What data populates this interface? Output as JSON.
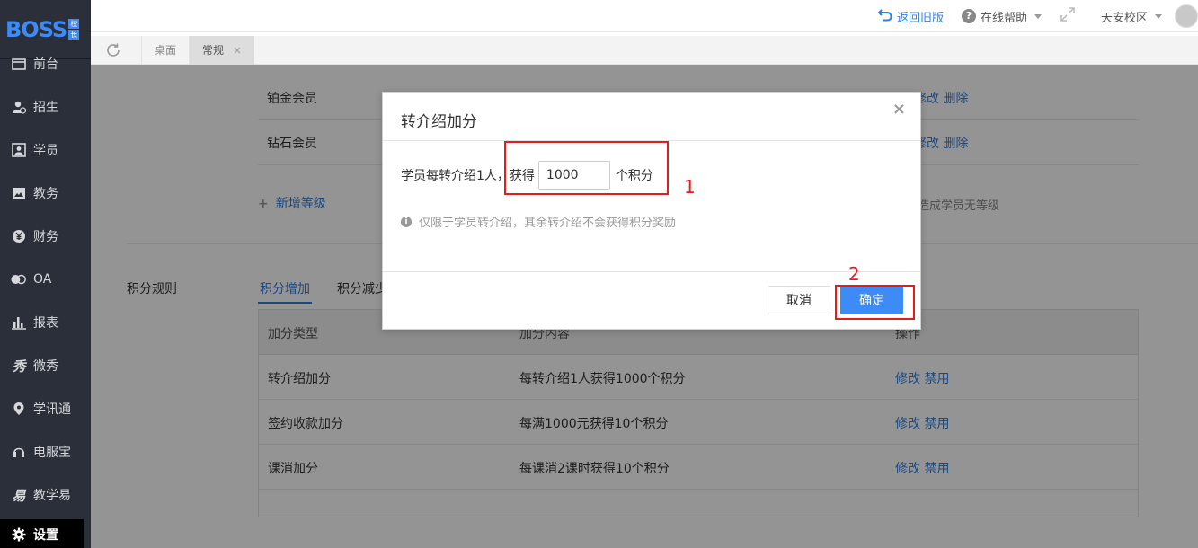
{
  "app": {
    "logo_text": "BOSS",
    "logo_badge": [
      "校",
      "长"
    ]
  },
  "sidebar": {
    "items": [
      {
        "label": "前台",
        "icon": "calendar-icon"
      },
      {
        "label": "招生",
        "icon": "add-user-icon"
      },
      {
        "label": "学员",
        "icon": "id-card-icon"
      },
      {
        "label": "教务",
        "icon": "picture-icon"
      },
      {
        "label": "财务",
        "icon": "yen-icon"
      },
      {
        "label": "OA",
        "icon": "toggle-icon"
      },
      {
        "label": "报表",
        "icon": "bar-chart-icon"
      },
      {
        "label": "微秀",
        "icon": "xiu-icon"
      },
      {
        "label": "学讯通",
        "icon": "location-pin-icon"
      },
      {
        "label": "电服宝",
        "icon": "headset-icon"
      },
      {
        "label": "教学易",
        "icon": "yi-icon"
      },
      {
        "label": "设置",
        "icon": "gear-icon",
        "active": true
      }
    ]
  },
  "topbar": {
    "back_old": "返回旧版",
    "help": "在线帮助",
    "campus": "天安校区"
  },
  "tabs": [
    {
      "label": "桌面",
      "active": false
    },
    {
      "label": "常规",
      "active": true,
      "close": "×"
    }
  ],
  "members": [
    {
      "name": "铂金会员",
      "ops": "修改 删除"
    },
    {
      "name": "钻石会员",
      "ops": "修改 删除"
    }
  ],
  "add_level": "新增等级",
  "add_level_icon": "+",
  "note_right": "造成学员无等级",
  "rules": {
    "label": "积分规则",
    "tabs": [
      "积分增加",
      "积分减少"
    ],
    "headers": [
      "加分类型",
      "加分内容",
      "操作"
    ],
    "rows": [
      {
        "type": "转介绍加分",
        "content": "每转介绍1人获得1000个积分",
        "edit": "修改",
        "disable": "禁用"
      },
      {
        "type": "签约收款加分",
        "content": "每满1000元获得10个积分",
        "edit": "修改",
        "disable": "禁用"
      },
      {
        "type": "课消加分",
        "content": "每课消2课时获得10个积分",
        "edit": "修改",
        "disable": "禁用"
      }
    ]
  },
  "modal": {
    "title": "转介绍加分",
    "close": "×",
    "prefix": "学员每转介绍1人，获得",
    "value": "1000",
    "suffix": "个积分",
    "tip": "仅限于学员转介绍，其余转介绍不会获得积分奖励",
    "cancel": "取消",
    "confirm": "确定"
  },
  "annotations": [
    "1",
    "2"
  ],
  "colors": {
    "accent": "#3d8bf5",
    "link": "#2f7fe0",
    "sidebar_bg": "#2b2f3a",
    "annotation": "#e61c1c"
  }
}
